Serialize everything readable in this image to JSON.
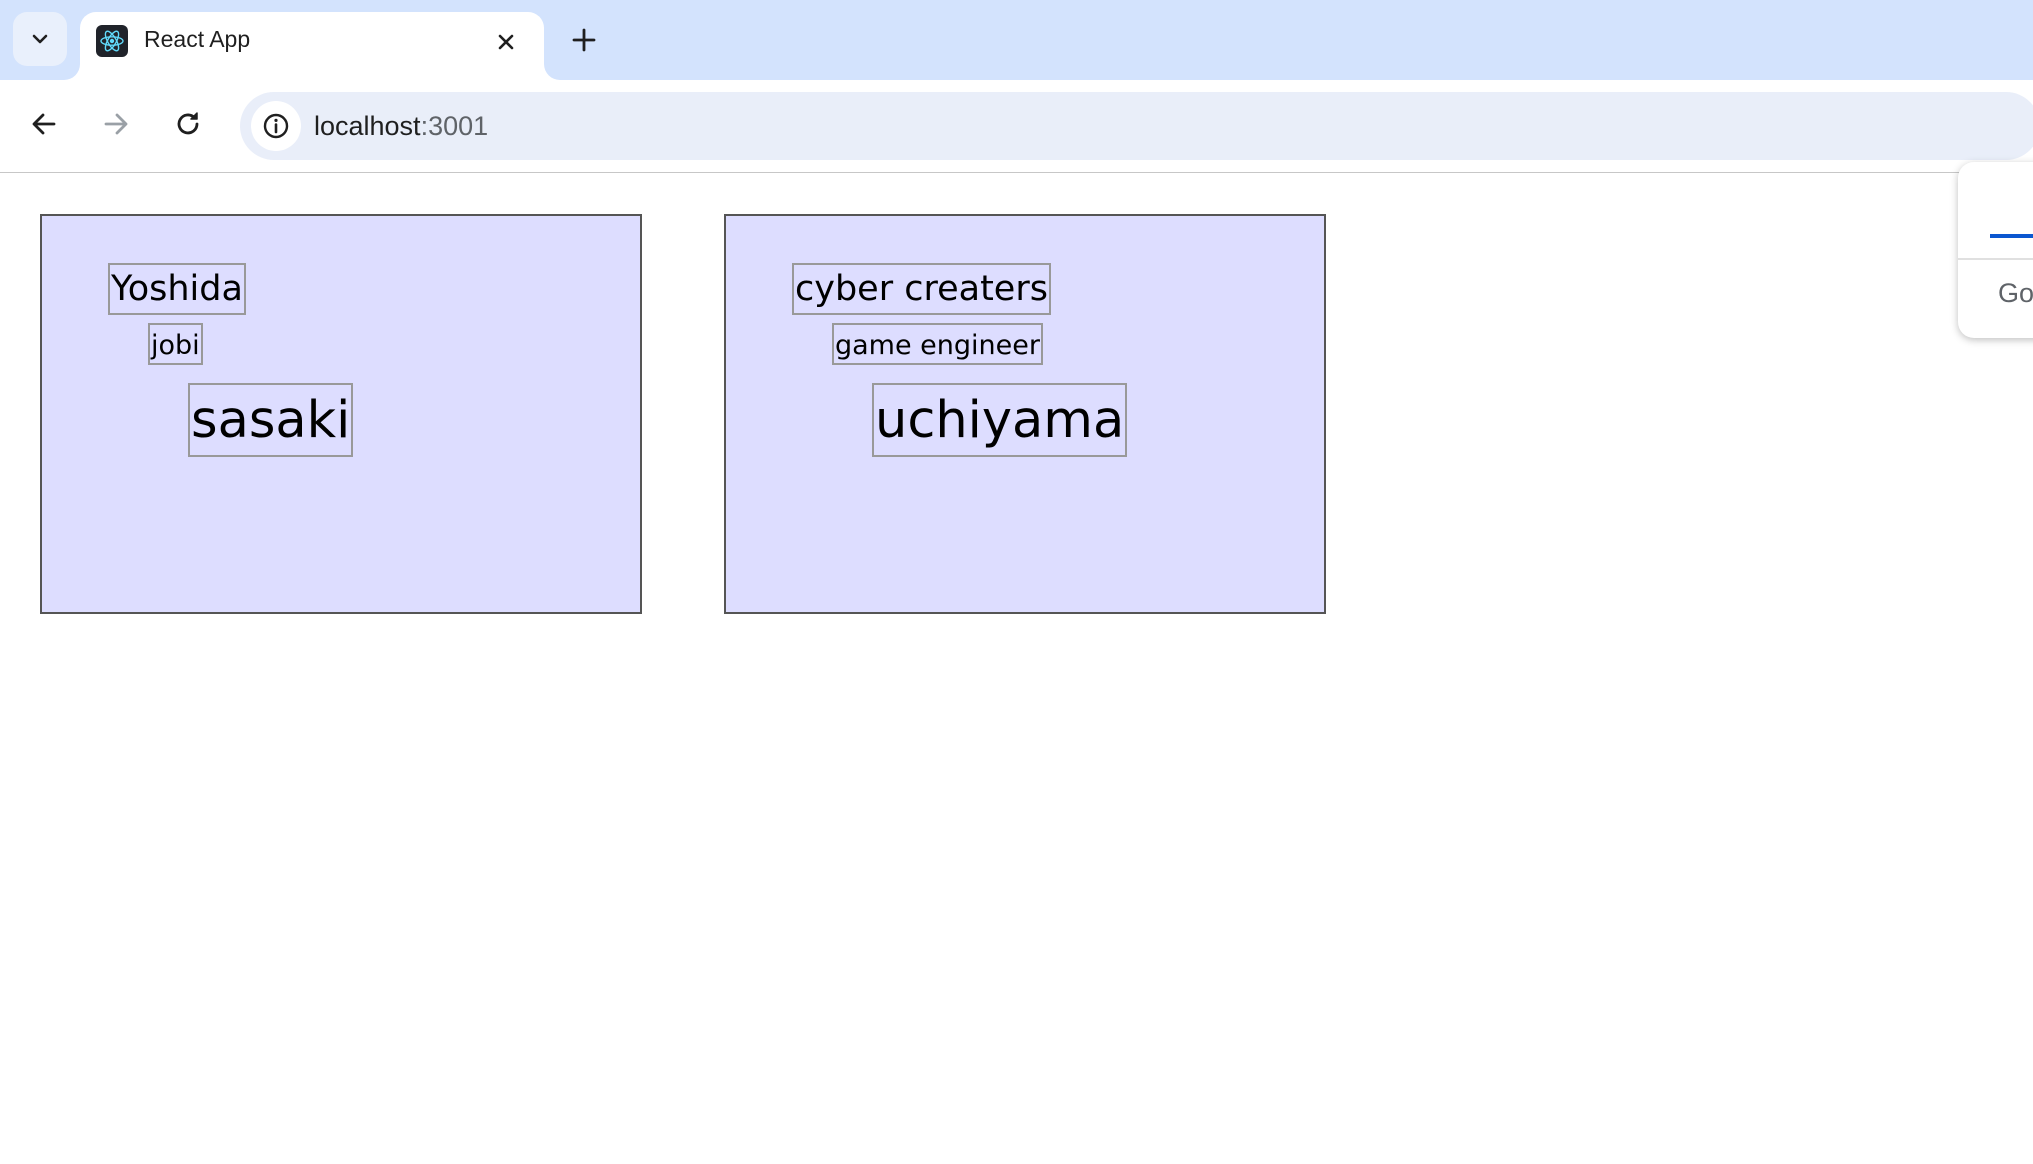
{
  "browser": {
    "tab": {
      "title": "React App",
      "favicon_icon": "react-logo-icon"
    },
    "tab_search_icon": "chevron-down-icon",
    "close_icon": "close-icon",
    "new_tab_icon": "plus-icon",
    "nav": {
      "back_icon": "arrow-back-icon",
      "forward_icon": "arrow-forward-icon",
      "reload_icon": "reload-icon"
    },
    "omnibox": {
      "site_info_icon": "info-icon",
      "url_host": "localhost",
      "url_port": ":3001"
    }
  },
  "cards": [
    {
      "company": "Yoshida",
      "job": "jobi",
      "name": "sasaki"
    },
    {
      "company": "cyber creaters",
      "job": "game engineer",
      "name": "uchiyama"
    }
  ],
  "popup": {
    "text": "Go"
  },
  "colors": {
    "tabstrip_bg": "#d3e3fd",
    "omnibox_bg": "#e9eef9",
    "card_bg": "#ddddff",
    "card_border": "#555555",
    "box_border": "#999999",
    "progress_accent": "#0b57d0"
  }
}
